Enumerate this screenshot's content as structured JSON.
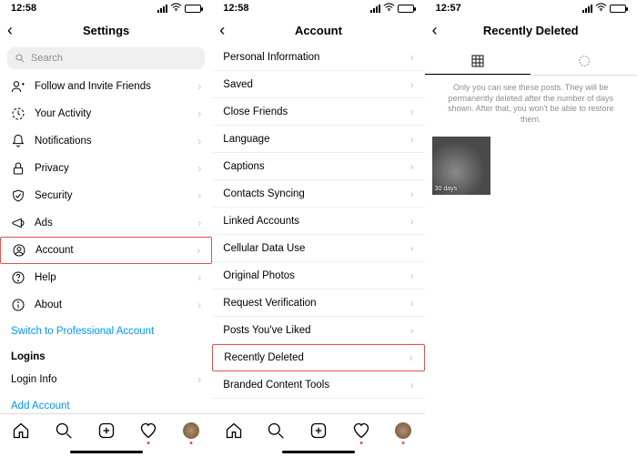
{
  "status": {
    "time1": "12:58",
    "time2": "12:58",
    "time3": "12:57"
  },
  "screen1": {
    "title": "Settings",
    "search_placeholder": "Search",
    "items": [
      {
        "icon": "follow",
        "label": "Follow and Invite Friends"
      },
      {
        "icon": "activity",
        "label": "Your Activity"
      },
      {
        "icon": "bell",
        "label": "Notifications"
      },
      {
        "icon": "lock",
        "label": "Privacy"
      },
      {
        "icon": "shield",
        "label": "Security"
      },
      {
        "icon": "ads",
        "label": "Ads"
      },
      {
        "icon": "account",
        "label": "Account",
        "highlight": true
      },
      {
        "icon": "help",
        "label": "Help"
      },
      {
        "icon": "about",
        "label": "About"
      }
    ],
    "switch_account": "Switch to Professional Account",
    "logins_header": "Logins",
    "login_info": "Login Info",
    "add_account": "Add Account"
  },
  "screen2": {
    "title": "Account",
    "items": [
      {
        "label": "Personal Information"
      },
      {
        "label": "Saved"
      },
      {
        "label": "Close Friends"
      },
      {
        "label": "Language"
      },
      {
        "label": "Captions"
      },
      {
        "label": "Contacts Syncing"
      },
      {
        "label": "Linked Accounts"
      },
      {
        "label": "Cellular Data Use"
      },
      {
        "label": "Original Photos"
      },
      {
        "label": "Request Verification"
      },
      {
        "label": "Posts You've Liked"
      },
      {
        "label": "Recently Deleted",
        "highlight": true
      },
      {
        "label": "Branded Content Tools"
      }
    ]
  },
  "screen3": {
    "title": "Recently Deleted",
    "info": "Only you can see these posts. They will be permanently deleted after the number of days shown. After that, you won't be able to restore them.",
    "thumb_days": "30 days"
  },
  "chevron": "›"
}
